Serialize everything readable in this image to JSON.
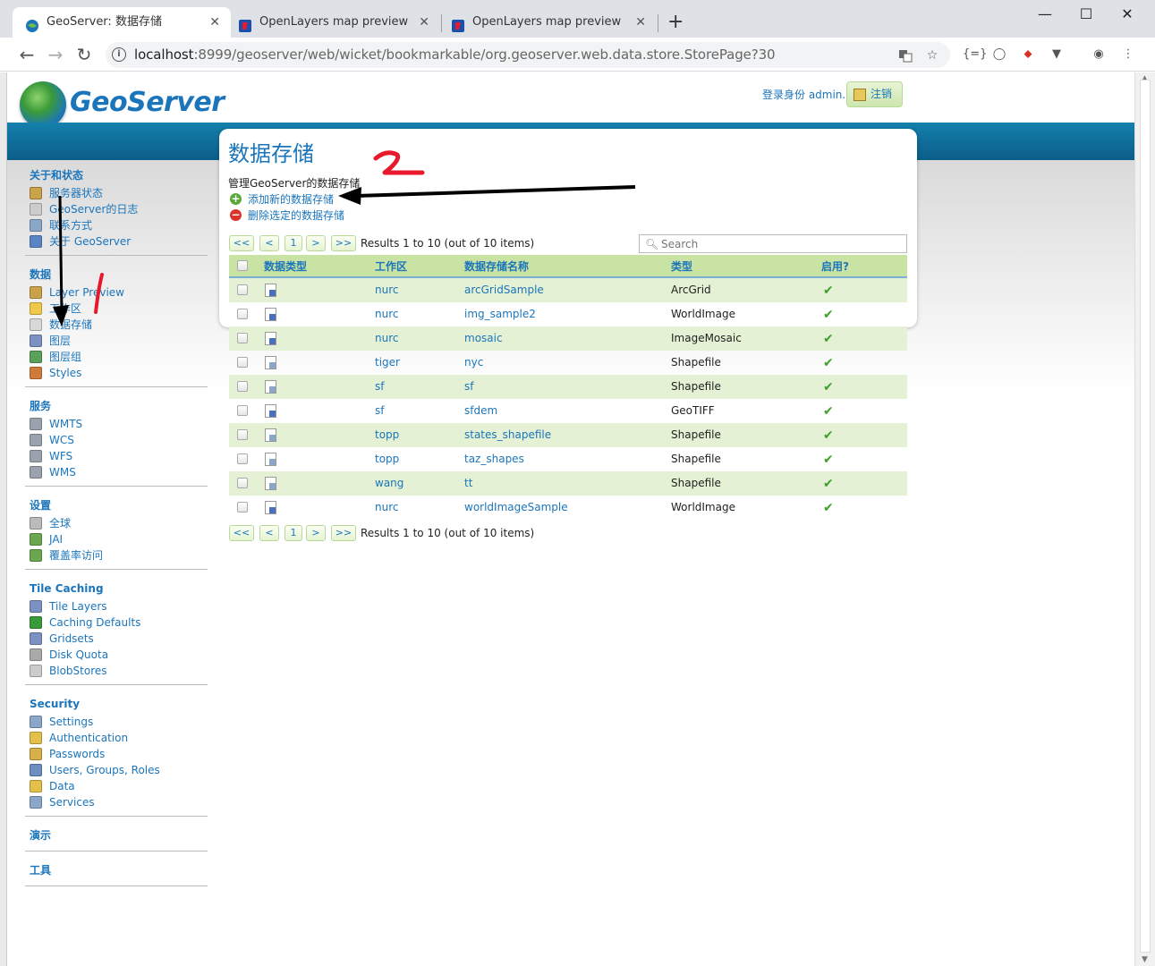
{
  "browser": {
    "tabs": [
      {
        "title": "GeoServer: 数据存储",
        "active": true
      },
      {
        "title": "OpenLayers map preview",
        "active": false
      },
      {
        "title": "OpenLayers map preview",
        "active": false
      }
    ],
    "tab_close": "✕",
    "new_tab": "+",
    "window": {
      "minimize": "—",
      "maximize": "☐",
      "close": "✕"
    },
    "nav": {
      "back": "←",
      "forward": "→",
      "reload": "↻"
    },
    "url_host": "localhost",
    "url_rest": ":8999/geoserver/web/wicket/bookmarkable/org.geoserver.web.data.store.StorePage?30",
    "info_icon": "i",
    "extensions": [
      "{=}",
      "◯",
      "⬥",
      "▼",
      "◉",
      "⋮"
    ]
  },
  "header": {
    "logo_text": "GeoServer",
    "login_label": "登录身份 admin.",
    "logout_label": "注销"
  },
  "sidebar": [
    {
      "title": "关于和状态",
      "items": [
        {
          "label": "服务器状态",
          "icon": "server-status-icon",
          "color": "#c9a24a"
        },
        {
          "label": "GeoServer的日志",
          "icon": "log-icon",
          "color": "#cccccc"
        },
        {
          "label": "联系方式",
          "icon": "contact-icon",
          "color": "#8aa6c8"
        },
        {
          "label": "关于 GeoServer",
          "icon": "about-icon",
          "color": "#5b84c4"
        }
      ]
    },
    {
      "title": "数据",
      "items": [
        {
          "label": "Layer Preview",
          "icon": "layer-preview-icon",
          "color": "#c9a24a"
        },
        {
          "label": "工作区",
          "icon": "folder-icon",
          "color": "#f0c94a"
        },
        {
          "label": "数据存储",
          "icon": "store-icon",
          "color": "#d8d8d8"
        },
        {
          "label": "图层",
          "icon": "layer-icon",
          "color": "#7b92c2"
        },
        {
          "label": "图层组",
          "icon": "layer-group-icon",
          "color": "#5aa05a"
        },
        {
          "label": "Styles",
          "icon": "styles-icon",
          "color": "#d07b3a"
        }
      ]
    },
    {
      "title": "服务",
      "items": [
        {
          "label": "WMTS",
          "icon": "wmts-icon",
          "color": "#9aa3ad"
        },
        {
          "label": "WCS",
          "icon": "wcs-icon",
          "color": "#9aa3ad"
        },
        {
          "label": "WFS",
          "icon": "wfs-icon",
          "color": "#9aa3ad"
        },
        {
          "label": "WMS",
          "icon": "wms-icon",
          "color": "#9aa3ad"
        }
      ]
    },
    {
      "title": "设置",
      "items": [
        {
          "label": "全球",
          "icon": "global-settings-icon",
          "color": "#bbbbbb"
        },
        {
          "label": "JAI",
          "icon": "jai-icon",
          "color": "#6aa84f"
        },
        {
          "label": "覆盖率访问",
          "icon": "coverage-access-icon",
          "color": "#6aa84f"
        }
      ]
    },
    {
      "title": "Tile Caching",
      "items": [
        {
          "label": "Tile Layers",
          "icon": "tile-layers-icon",
          "color": "#7b92c2"
        },
        {
          "label": "Caching Defaults",
          "icon": "caching-defaults-icon",
          "color": "#3a9a3a"
        },
        {
          "label": "Gridsets",
          "icon": "gridsets-icon",
          "color": "#7b92c2"
        },
        {
          "label": "Disk Quota",
          "icon": "disk-quota-icon",
          "color": "#aaaaaa"
        },
        {
          "label": "BlobStores",
          "icon": "blobstores-icon",
          "color": "#cccccc"
        }
      ]
    },
    {
      "title": "Security",
      "items": [
        {
          "label": "Settings",
          "icon": "wrench-icon",
          "color": "#8aa6c8"
        },
        {
          "label": "Authentication",
          "icon": "shield-icon",
          "color": "#e2c04a"
        },
        {
          "label": "Passwords",
          "icon": "lock-icon",
          "color": "#d8b04a"
        },
        {
          "label": "Users, Groups, Roles",
          "icon": "users-icon",
          "color": "#6a8fc0"
        },
        {
          "label": "Data",
          "icon": "data-security-icon",
          "color": "#e2c04a"
        },
        {
          "label": "Services",
          "icon": "services-security-icon",
          "color": "#8aa6c8"
        }
      ]
    },
    {
      "title": "演示",
      "items": []
    },
    {
      "title": "工具",
      "items": []
    }
  ],
  "main": {
    "title": "数据存储",
    "description": "管理GeoServer的数据存储",
    "add_label": "添加新的数据存储",
    "remove_label": "删除选定的数据存储",
    "pager": {
      "first": "<<",
      "prev": "<",
      "page": "1",
      "next": ">",
      "last": ">>",
      "summary": "Results 1 to 10 (out of 10 items)"
    },
    "search_placeholder": "Search",
    "columns": [
      "数据类型",
      "工作区",
      "数据存储名称",
      "类型",
      "启用?"
    ],
    "enabled_mark": "✔",
    "rows": [
      {
        "workspace": "nurc",
        "name": "arcGridSample",
        "type": "ArcGrid",
        "kind": "raster"
      },
      {
        "workspace": "nurc",
        "name": "img_sample2",
        "type": "WorldImage",
        "kind": "raster"
      },
      {
        "workspace": "nurc",
        "name": "mosaic",
        "type": "ImageMosaic",
        "kind": "raster"
      },
      {
        "workspace": "tiger",
        "name": "nyc",
        "type": "Shapefile",
        "kind": "vector"
      },
      {
        "workspace": "sf",
        "name": "sf",
        "type": "Shapefile",
        "kind": "vector"
      },
      {
        "workspace": "sf",
        "name": "sfdem",
        "type": "GeoTIFF",
        "kind": "raster"
      },
      {
        "workspace": "topp",
        "name": "states_shapefile",
        "type": "Shapefile",
        "kind": "vector"
      },
      {
        "workspace": "topp",
        "name": "taz_shapes",
        "type": "Shapefile",
        "kind": "vector"
      },
      {
        "workspace": "wang",
        "name": "tt",
        "type": "Shapefile",
        "kind": "vector"
      },
      {
        "workspace": "nurc",
        "name": "worldImageSample",
        "type": "WorldImage",
        "kind": "raster"
      }
    ]
  },
  "colors": {
    "brand_blue": "#1b75bb",
    "header_bar": "#0a6e9c",
    "row_green": "#e4f1d4",
    "header_green": "#c9e3a4",
    "annotation_red": "#e8192c",
    "annotation_black": "#000000"
  }
}
